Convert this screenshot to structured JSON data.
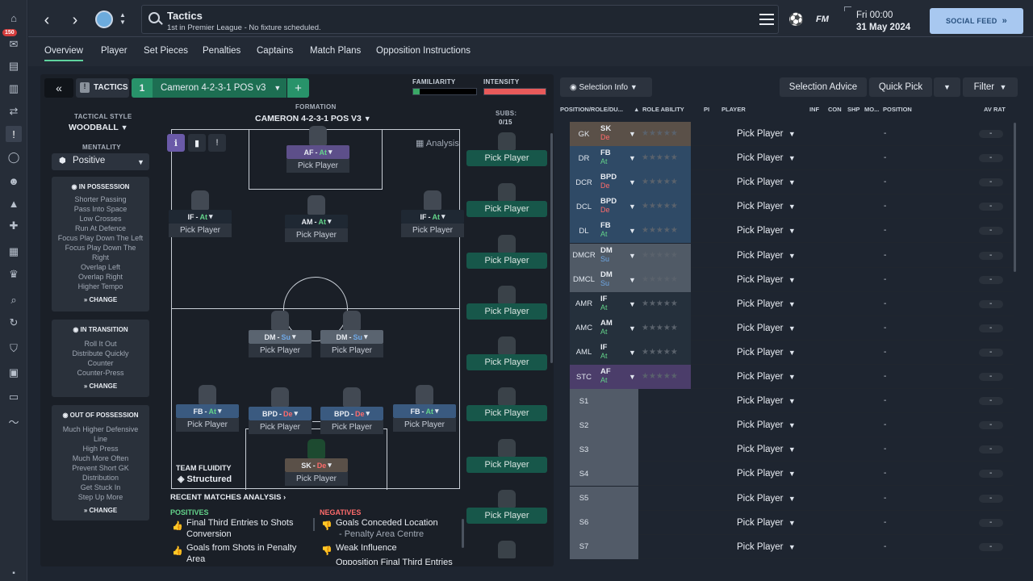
{
  "sidebar": {
    "badge": "150"
  },
  "header": {
    "title": "Tactics",
    "subtitle": "1st in Premier League - No fixture scheduled.",
    "brand": "FM",
    "day_time": "Fri 00:00",
    "date": "31 May 2024",
    "social_feed": "SOCIAL FEED"
  },
  "tabs": [
    "Overview",
    "Player",
    "Set Pieces",
    "Penalties",
    "Captains",
    "Match Plans",
    "Opposition Instructions"
  ],
  "tactic": {
    "label": "TACTICS",
    "slot": "1",
    "name": "Cameron 4-2-3-1 POS v3",
    "familiarity": "FAMILIARITY",
    "intensity": "INTENSITY",
    "style_label": "TACTICAL STYLE",
    "style": "WOODBALL",
    "mentality_label": "MENTALITY",
    "mentality": "Positive",
    "formation_label": "FORMATION",
    "formation": "CAMERON 4-2-3-1 POS V3",
    "subs_label": "SUBS:",
    "subs_count": "0/15",
    "analysis": "Analysis",
    "fluidity_label": "TEAM FLUIDITY",
    "fluidity": "Structured"
  },
  "in_possession": {
    "title": "IN POSSESSION",
    "items": [
      "Shorter Passing",
      "Pass Into Space",
      "Low Crosses",
      "Run At Defence",
      "Focus Play Down The Left",
      "Focus Play Down The",
      "Right",
      "Overlap Left",
      "Overlap Right",
      "Higher Tempo"
    ],
    "change": "CHANGE"
  },
  "in_transition": {
    "title": "IN TRANSITION",
    "items": [
      "Roll It Out",
      "Distribute Quickly",
      "Counter",
      "Counter-Press"
    ],
    "change": "CHANGE"
  },
  "out_possession": {
    "title": "OUT OF POSSESSION",
    "items": [
      "Much Higher Defensive",
      "Line",
      "High Press",
      "Much More Often",
      "Prevent Short GK",
      "Distribution",
      "Get Stuck In",
      "Step Up More"
    ],
    "change": "CHANGE"
  },
  "pick_player": "Pick Player",
  "pitch_positions": [
    {
      "role": "AF",
      "duty": "At"
    },
    {
      "role": "IF",
      "duty": "At"
    },
    {
      "role": "AM",
      "duty": "At"
    },
    {
      "role": "IF",
      "duty": "At"
    },
    {
      "role": "DM",
      "duty": "Su"
    },
    {
      "role": "DM",
      "duty": "Su"
    },
    {
      "role": "FB",
      "duty": "At"
    },
    {
      "role": "BPD",
      "duty": "De"
    },
    {
      "role": "BPD",
      "duty": "De"
    },
    {
      "role": "FB",
      "duty": "At"
    },
    {
      "role": "SK",
      "duty": "De"
    }
  ],
  "recent": {
    "title": "RECENT MATCHES ANALYSIS",
    "positives_label": "POSITIVES",
    "positives": [
      "Final Third Entries to Shots",
      "Conversion",
      "Goals from Shots in Penalty",
      "Area"
    ],
    "negatives_label": "NEGATIVES",
    "negatives": [
      "Goals Conceded Location",
      "- Penalty Area Centre",
      "Weak Influence",
      "Opposition Final Third Entries"
    ]
  },
  "right": {
    "selection_info": "Selection Info",
    "selection_advice": "Selection Advice",
    "quick_pick": "Quick Pick",
    "filter": "Filter",
    "columns": [
      "POSITION/ROLE/DU...",
      "ROLE ABILITY",
      "PI",
      "PLAYER",
      "INF",
      "CON",
      "SHP",
      "MO...",
      "POSITION",
      "AV RAT"
    ],
    "rows": [
      {
        "pos": "GK",
        "role": "SK",
        "duty": "De"
      },
      {
        "pos": "DR",
        "role": "FB",
        "duty": "At"
      },
      {
        "pos": "DCR",
        "role": "BPD",
        "duty": "De"
      },
      {
        "pos": "DCL",
        "role": "BPD",
        "duty": "De"
      },
      {
        "pos": "DL",
        "role": "FB",
        "duty": "At"
      },
      {
        "pos": "DMCR",
        "role": "DM",
        "duty": "Su"
      },
      {
        "pos": "DMCL",
        "role": "DM",
        "duty": "Su"
      },
      {
        "pos": "AMR",
        "role": "IF",
        "duty": "At"
      },
      {
        "pos": "AMC",
        "role": "AM",
        "duty": "At"
      },
      {
        "pos": "AML",
        "role": "IF",
        "duty": "At"
      },
      {
        "pos": "STC",
        "role": "AF",
        "duty": "At"
      },
      {
        "pos": "S1",
        "role": "",
        "duty": ""
      },
      {
        "pos": "S2",
        "role": "",
        "duty": ""
      },
      {
        "pos": "S3",
        "role": "",
        "duty": ""
      },
      {
        "pos": "S4",
        "role": "",
        "duty": ""
      },
      {
        "pos": "S5",
        "role": "",
        "duty": ""
      },
      {
        "pos": "S6",
        "role": "",
        "duty": ""
      },
      {
        "pos": "S7",
        "role": "",
        "duty": ""
      }
    ],
    "dash": "-"
  },
  "colors": {
    "accent": "#5fd39e",
    "gk": "#5a5048",
    "def": "#2f4a66",
    "mid": "#505a66",
    "att": "#25303c",
    "st": "#4b3d6a"
  }
}
